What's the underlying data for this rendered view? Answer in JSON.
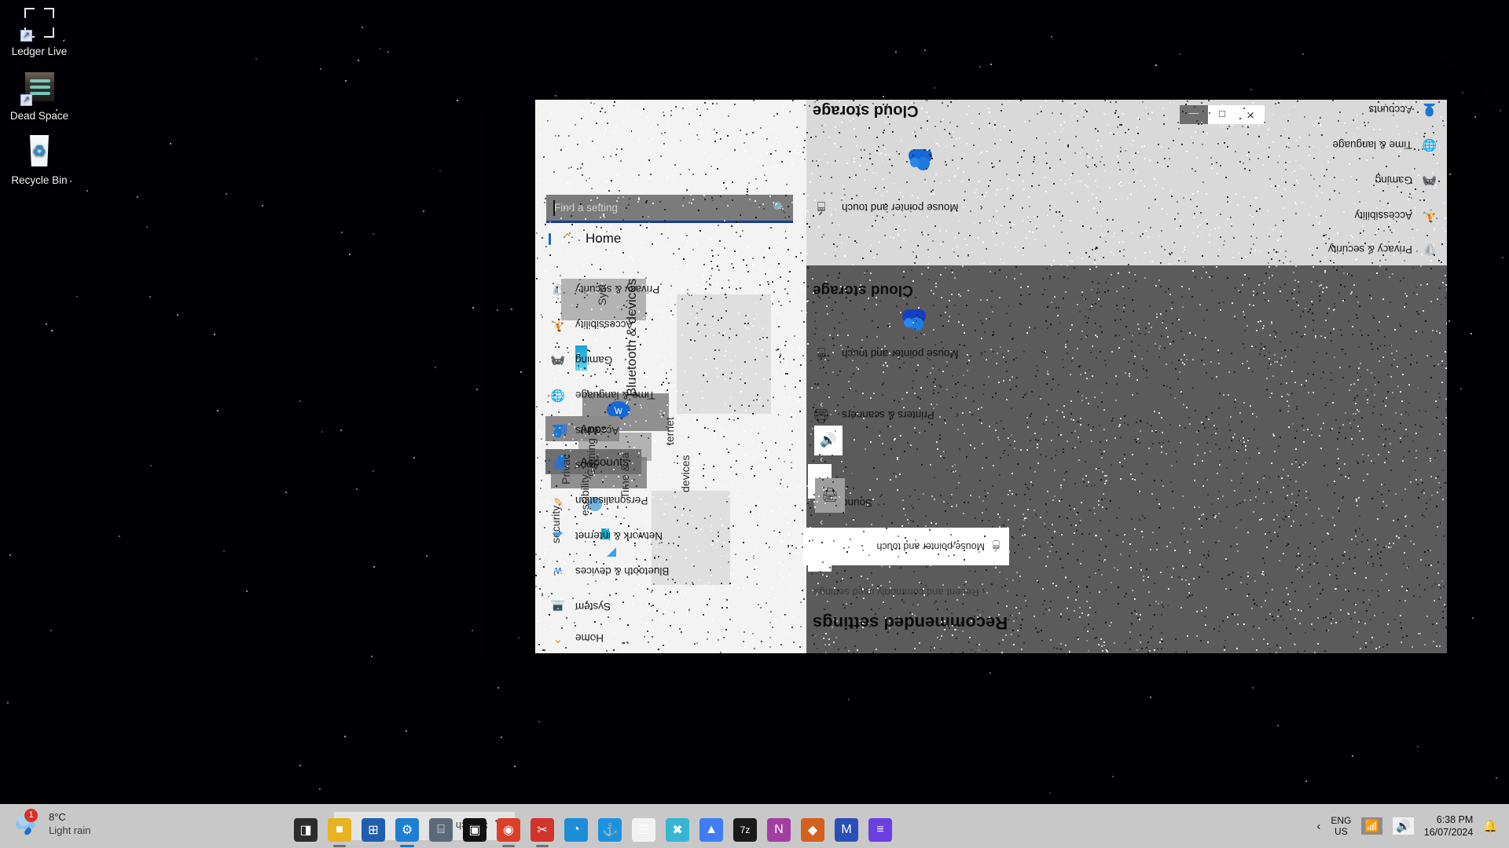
{
  "desktop": {
    "icons": [
      {
        "label": "Ledger Live",
        "icon": "ledger-live-icon"
      },
      {
        "label": "Dead Space",
        "icon": "dead-space-icon"
      },
      {
        "label": "Recycle Bin",
        "icon": "recycle-bin-icon"
      }
    ]
  },
  "settings_window": {
    "title_controls": {
      "minimize": "—",
      "maximize": "□",
      "close": "✕"
    },
    "search": {
      "placeholder": "Find a setting",
      "value": "Find a setting",
      "icon": "search-icon"
    },
    "sidebar": {
      "home_label": "Home",
      "items": [
        {
          "label": "Apps",
          "icon": "apps-icon"
        },
        {
          "label": "Accounts",
          "icon": "accounts-icon"
        },
        {
          "label": "Gaming",
          "icon": "gaming-icon"
        },
        {
          "label": "Accessibility",
          "icon": "accessibility-icon"
        },
        {
          "label": "Privacy & security",
          "icon": "shield-icon"
        }
      ],
      "rotated_labels": [
        {
          "label": "Bluetooth & devices"
        },
        {
          "label": "Syst"
        },
        {
          "label": "Time & la"
        },
        {
          "label": "Privac"
        },
        {
          "label": "ternet"
        },
        {
          "label": "devices"
        },
        {
          "label": "essibility"
        },
        {
          "label": "security"
        }
      ]
    },
    "nav_flipped": {
      "items": [
        {
          "label": "Privacy & security",
          "icon": "shield-icon"
        },
        {
          "label": "Accessibility",
          "icon": "accessibility-icon"
        },
        {
          "label": "Gaming",
          "icon": "gaming-icon"
        },
        {
          "label": "Time & language",
          "icon": "time-language-icon"
        },
        {
          "label": "Accounts",
          "icon": "accounts-icon"
        },
        {
          "label": "Apps",
          "icon": "apps-icon"
        },
        {
          "label": "Personalisation",
          "icon": "personalisation-icon"
        },
        {
          "label": "Network & internet",
          "icon": "network-icon"
        },
        {
          "label": "Bluetooth & devices",
          "icon": "bluetooth-icon"
        },
        {
          "label": "System",
          "icon": "system-icon"
        },
        {
          "label": "Home",
          "icon": "home-icon"
        }
      ]
    },
    "content": {
      "heading": "Recommended settings",
      "subheading": "Recent and commonly used settings",
      "cloud_storage_label": "Cloud storage",
      "rows": [
        {
          "label": "Mouse pointer and touch",
          "icon": "mouse-pointer-icon",
          "chevron": "‹"
        },
        {
          "label": "Printers & scanners",
          "icon": "printer-icon",
          "chevron": "‹"
        },
        {
          "label": "Sound",
          "icon": "sound-icon",
          "chevron": "‹"
        }
      ],
      "floating_card_label": "Mouse pointer and touch",
      "collapse_up": "⌃",
      "collapse_down": "⌄"
    }
  },
  "taskbar": {
    "weather": {
      "temperature": "8°C",
      "condition": "Light rain",
      "badge": "1",
      "icon": "rain-cloud-icon"
    },
    "search": {
      "label": "Search",
      "icon": "search-icon"
    },
    "apps": [
      {
        "name": "file-explorer",
        "glyph": "◨",
        "color": "#2c2c2c",
        "active": false
      },
      {
        "name": "windows-explorer-yellow",
        "glyph": "■",
        "color": "#e8b321",
        "active": true
      },
      {
        "name": "microsoft-store",
        "glyph": "⊞",
        "color": "#1f5fb0",
        "active": false
      },
      {
        "name": "settings",
        "glyph": "⚙",
        "color": "#1c7fd4",
        "active": true
      },
      {
        "name": "calculator",
        "glyph": "⌸",
        "color": "#5a6a7a",
        "active": false
      },
      {
        "name": "terminal",
        "glyph": "▣",
        "color": "#111111",
        "active": false
      },
      {
        "name": "google-chrome",
        "glyph": "◉",
        "color": "#d93f2b",
        "active": true
      },
      {
        "name": "snipping-tool",
        "glyph": "✂",
        "color": "#d0342c",
        "active": true
      },
      {
        "name": "microsoft-edge",
        "glyph": "◔",
        "color": "#1b8ed6",
        "active": false
      },
      {
        "name": "docker",
        "glyph": "⚓",
        "color": "#1d91e0",
        "active": false
      },
      {
        "name": "notepad",
        "glyph": "☰",
        "color": "#f2f2f2",
        "active": false
      },
      {
        "name": "xampp",
        "glyph": "✖",
        "color": "#37b6d2",
        "active": false
      },
      {
        "name": "nordvpn",
        "glyph": "▲",
        "color": "#3f7ef0",
        "active": false
      },
      {
        "name": "seven-zip",
        "glyph": "7z",
        "color": "#1a1a1a",
        "active": false
      },
      {
        "name": "onenote",
        "glyph": "N",
        "color": "#a33ea1",
        "active": false
      },
      {
        "name": "office-app",
        "glyph": "◆",
        "color": "#d4601f",
        "active": false
      },
      {
        "name": "mirror-app",
        "glyph": "M",
        "color": "#2a4fb8",
        "active": false
      },
      {
        "name": "purple-app",
        "glyph": "≡",
        "color": "#6c3fe0",
        "active": false
      }
    ],
    "tray": {
      "chevron": "‹",
      "language_line1": "ENG",
      "language_line2": "US",
      "network_icon": "wifi-icon",
      "volume_icon": "volume-icon",
      "time": "6:38 PM",
      "date": "16/07/2024",
      "notification_icon": "bell-icon"
    }
  },
  "colors": {
    "accent": "#1668c8",
    "taskbar_bg": "#c8c8c8",
    "window_light": "#f3f3f3",
    "window_dark": "#5b5b5b",
    "badge_red": "#d93025"
  }
}
